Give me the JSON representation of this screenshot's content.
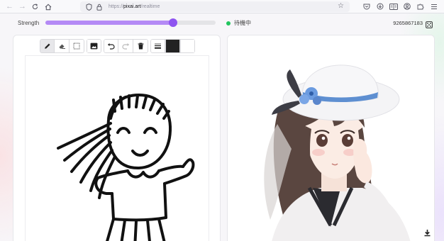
{
  "browser": {
    "url_prefix": "https://",
    "url_host": "pixai.art",
    "url_path": "/realtime"
  },
  "controls": {
    "strength_label": "Strength",
    "strength_value": 0.75,
    "status_text": "待機中",
    "seed_text": "9265867183"
  },
  "tools": {
    "pen": "pen-icon",
    "eraser": "eraser-icon",
    "select": "select-icon",
    "image": "image-icon",
    "undo": "undo-icon",
    "redo": "redo-icon",
    "delete": "trash-icon",
    "width": "line-width-icon",
    "color_primary": "#222222",
    "color_secondary": "#ffffff"
  },
  "colors": {
    "accent": "#8e54f0",
    "accent_light": "#b48af5",
    "status_ok": "#22c55e"
  }
}
